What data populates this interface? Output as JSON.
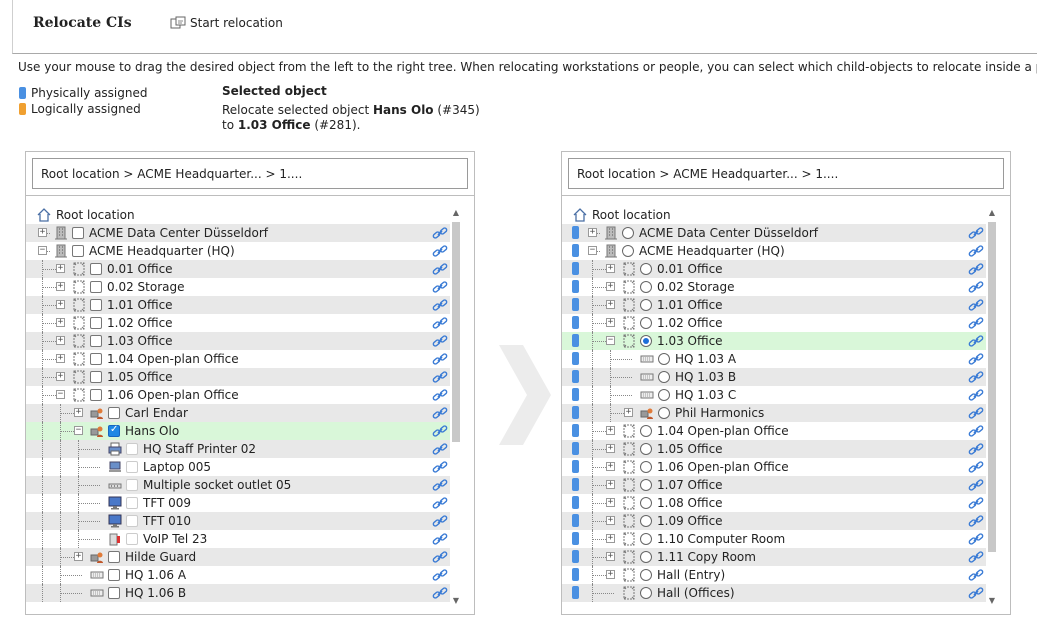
{
  "header": {
    "title": "Relocate CIs",
    "start_button": "Start relocation"
  },
  "description": "Use your mouse to drag the desired object from the left to the right tree. When relocating workstations or people, you can select which child-objects to relocate inside a popup window.",
  "legend": {
    "items": [
      {
        "label": "Physically assigned",
        "color": "#4a90e2"
      },
      {
        "label": "Logically assigned",
        "color": "#f0a030"
      }
    ]
  },
  "selected": {
    "heading": "Selected object",
    "line1_prefix": "Relocate selected object ",
    "object": "Hans Olo",
    "object_id": " (#345)",
    "line2_prefix": "to ",
    "target": "1.03 Office",
    "target_id": " (#281)."
  },
  "left": {
    "breadcrumb": "Root location > ACME Headquarter... > 1....",
    "root": "Root location",
    "rows": [
      {
        "label": "ACME Data Center Düsseldorf",
        "level": 0,
        "exp": "+",
        "icon": "building"
      },
      {
        "label": "ACME Headquarter (HQ)",
        "level": 0,
        "exp": "-",
        "icon": "building"
      },
      {
        "label": "0.01 Office",
        "level": 1,
        "exp": "+",
        "icon": "room"
      },
      {
        "label": "0.02 Storage",
        "level": 1,
        "exp": "+",
        "icon": "room"
      },
      {
        "label": "1.01 Office",
        "level": 1,
        "exp": "+",
        "icon": "room"
      },
      {
        "label": "1.02 Office",
        "level": 1,
        "exp": "+",
        "icon": "room"
      },
      {
        "label": "1.03 Office",
        "level": 1,
        "exp": "+",
        "icon": "room"
      },
      {
        "label": "1.04 Open-plan Office",
        "level": 1,
        "exp": "+",
        "icon": "room"
      },
      {
        "label": "1.05 Office",
        "level": 1,
        "exp": "+",
        "icon": "room"
      },
      {
        "label": "1.06 Open-plan Office",
        "level": 1,
        "exp": "-",
        "icon": "room"
      },
      {
        "label": "Carl Endar",
        "level": 2,
        "exp": "+",
        "icon": "person"
      },
      {
        "label": "Hans Olo",
        "level": 2,
        "exp": "-",
        "icon": "person",
        "checked": true,
        "hl": true
      },
      {
        "label": "HQ Staff Printer 02",
        "level": 3,
        "icon": "printer",
        "dis": true
      },
      {
        "label": "Laptop 005",
        "level": 3,
        "icon": "laptop",
        "dis": true
      },
      {
        "label": "Multiple socket outlet 05",
        "level": 3,
        "icon": "socket",
        "dis": true
      },
      {
        "label": "TFT 009",
        "level": 3,
        "icon": "monitor",
        "dis": true
      },
      {
        "label": "TFT 010",
        "level": 3,
        "icon": "monitor",
        "dis": true
      },
      {
        "label": "VoIP Tel 23",
        "level": 3,
        "icon": "phone",
        "dis": true
      },
      {
        "label": "Hilde Guard",
        "level": 2,
        "exp": "+",
        "icon": "person"
      },
      {
        "label": "HQ 1.06 A",
        "level": 2,
        "icon": "desk"
      },
      {
        "label": "HQ 1.06 B",
        "level": 2,
        "icon": "desk"
      }
    ]
  },
  "right": {
    "breadcrumb": "Root location > ACME Headquarter... > 1....",
    "root": "Root location",
    "rows": [
      {
        "label": "ACME Data Center Düsseldorf",
        "level": 0,
        "exp": "+",
        "icon": "building"
      },
      {
        "label": "ACME Headquarter (HQ)",
        "level": 0,
        "exp": "-",
        "icon": "building"
      },
      {
        "label": "0.01 Office",
        "level": 1,
        "exp": "+",
        "icon": "room"
      },
      {
        "label": "0.02 Storage",
        "level": 1,
        "exp": "+",
        "icon": "room"
      },
      {
        "label": "1.01 Office",
        "level": 1,
        "exp": "+",
        "icon": "room"
      },
      {
        "label": "1.02 Office",
        "level": 1,
        "exp": "+",
        "icon": "room"
      },
      {
        "label": "1.03 Office",
        "level": 1,
        "exp": "-",
        "icon": "room",
        "checked": true,
        "hl": true
      },
      {
        "label": "HQ 1.03 A",
        "level": 2,
        "icon": "desk"
      },
      {
        "label": "HQ 1.03 B",
        "level": 2,
        "icon": "desk"
      },
      {
        "label": "HQ 1.03 C",
        "level": 2,
        "icon": "desk"
      },
      {
        "label": "Phil Harmonics",
        "level": 2,
        "exp": "+",
        "icon": "person"
      },
      {
        "label": "1.04 Open-plan Office",
        "level": 1,
        "exp": "+",
        "icon": "room"
      },
      {
        "label": "1.05 Office",
        "level": 1,
        "exp": "+",
        "icon": "room"
      },
      {
        "label": "1.06 Open-plan Office",
        "level": 1,
        "exp": "+",
        "icon": "room"
      },
      {
        "label": "1.07 Office",
        "level": 1,
        "exp": "+",
        "icon": "room"
      },
      {
        "label": "1.08 Office",
        "level": 1,
        "exp": "+",
        "icon": "room"
      },
      {
        "label": "1.09 Office",
        "level": 1,
        "exp": "+",
        "icon": "room"
      },
      {
        "label": "1.10 Computer Room",
        "level": 1,
        "exp": "+",
        "icon": "room"
      },
      {
        "label": "1.11 Copy Room",
        "level": 1,
        "exp": "+",
        "icon": "room"
      },
      {
        "label": "Hall (Entry)",
        "level": 1,
        "exp": "+",
        "icon": "room"
      },
      {
        "label": "Hall (Offices)",
        "level": 1,
        "icon": "room"
      }
    ]
  }
}
